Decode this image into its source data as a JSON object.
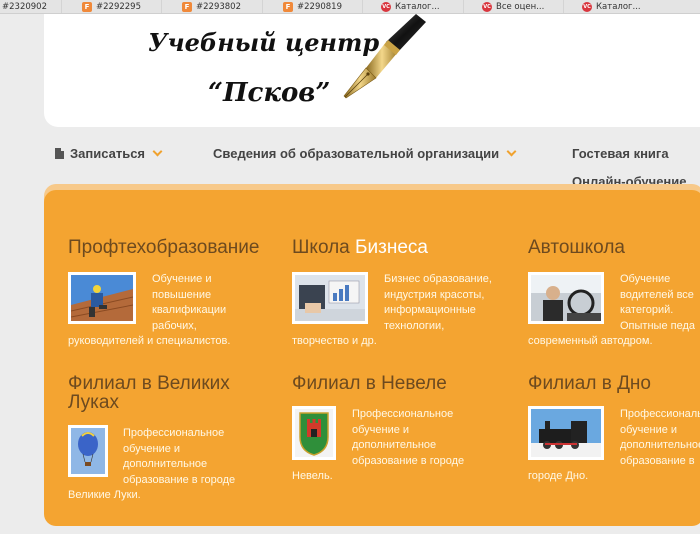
{
  "bookmarks": [
    {
      "label": "#2320902",
      "icon": "none"
    },
    {
      "label": "#2292295",
      "icon": "F"
    },
    {
      "label": "#2293802",
      "icon": "F"
    },
    {
      "label": "#2290819",
      "icon": "F"
    },
    {
      "label": "Каталог...",
      "icon": "VC"
    },
    {
      "label": "Все оцен...",
      "icon": "VC"
    },
    {
      "label": "Каталог...",
      "icon": "VC"
    }
  ],
  "logo": {
    "line1": "Учебный центр",
    "line2": "“Псков”"
  },
  "nav": {
    "enroll": "Записаться",
    "info": "Сведения об образовательной организации",
    "guestbook": "Гостевая книга",
    "online": "Онлайн-обучение"
  },
  "blocks": {
    "prof": {
      "title": "Профтехобразование",
      "text": [
        "Обучение и",
        "повышение",
        "квалификации",
        "рабочих,",
        "руководителей и специалистов."
      ]
    },
    "biz": {
      "title_a": "Школа ",
      "title_b": "Бизнеса",
      "text": [
        "Бизнес образование,",
        "индустрия красоты,",
        "информационные",
        "технологии,",
        "творчество и др."
      ]
    },
    "auto": {
      "title": "Автошкола",
      "text": [
        "Обучение",
        "водителей все",
        "категорий.",
        "Опытные педа",
        "современный автодром."
      ]
    },
    "vluki": {
      "title_l1": "Филиал в Великих",
      "title_l2": "Луках",
      "text": [
        "Профессиональное",
        "обучение и",
        "дополнительное",
        "образование в городе",
        "Великие Луки."
      ]
    },
    "nevel": {
      "title": "Филиал в Невеле",
      "text": [
        "Профессиональное",
        "обучение и",
        "дополнительное",
        "образование в городе",
        "Невель."
      ]
    },
    "dno": {
      "title": "Филиал в Дно",
      "text": [
        "Профессиональное",
        "обучение и",
        "дополнительное",
        "образование в",
        "городе Дно."
      ]
    }
  },
  "colors": {
    "panel": "#f4a431",
    "title": "#6d4a1f",
    "accent": "#f0a22e"
  }
}
